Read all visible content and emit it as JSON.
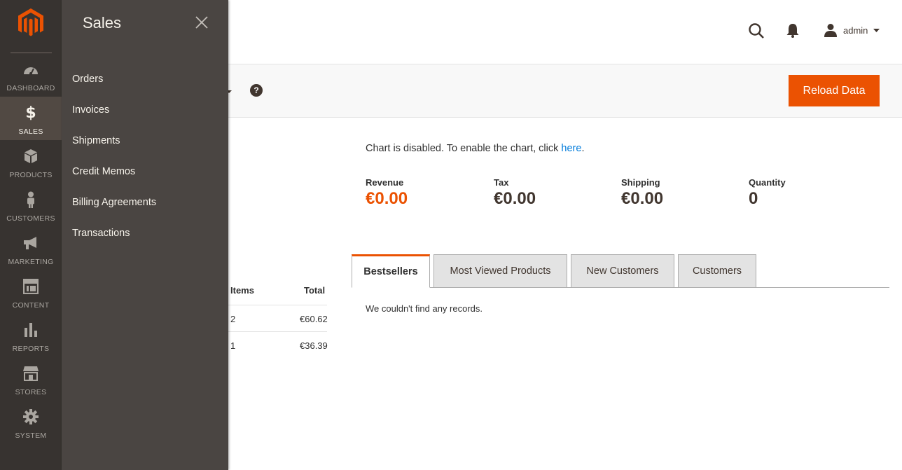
{
  "nav": {
    "items": [
      {
        "label": "DASHBOARD",
        "icon": "dashboard-icon"
      },
      {
        "label": "SALES",
        "icon": "dollar-icon"
      },
      {
        "label": "PRODUCTS",
        "icon": "box-icon"
      },
      {
        "label": "CUSTOMERS",
        "icon": "person-icon"
      },
      {
        "label": "MARKETING",
        "icon": "megaphone-icon"
      },
      {
        "label": "CONTENT",
        "icon": "layout-icon"
      },
      {
        "label": "REPORTS",
        "icon": "bar-chart-icon"
      },
      {
        "label": "STORES",
        "icon": "store-icon"
      },
      {
        "label": "SYSTEM",
        "icon": "gear-icon"
      }
    ],
    "active": "SALES"
  },
  "flyout": {
    "title": "Sales",
    "items": [
      "Orders",
      "Invoices",
      "Shipments",
      "Credit Memos",
      "Billing Agreements",
      "Transactions"
    ]
  },
  "header": {
    "user": "admin"
  },
  "actions": {
    "help_glyph": "?",
    "reload_label": "Reload Data"
  },
  "orders_table": {
    "headers": {
      "items": "Items",
      "total": "Total"
    },
    "rows": [
      {
        "items": "2",
        "total": "€60.62"
      },
      {
        "items": "1",
        "total": "€36.39"
      }
    ]
  },
  "chart_notice": {
    "text": "Chart is disabled. To enable the chart, click ",
    "link": "here",
    "suffix": "."
  },
  "stats": [
    {
      "label": "Revenue",
      "value": "€0.00"
    },
    {
      "label": "Tax",
      "value": "€0.00"
    },
    {
      "label": "Shipping",
      "value": "€0.00"
    },
    {
      "label": "Quantity",
      "value": "0"
    }
  ],
  "tabs": [
    {
      "label": "Bestsellers"
    },
    {
      "label": "Most Viewed Products"
    },
    {
      "label": "New Customers"
    },
    {
      "label": "Customers"
    }
  ],
  "active_tab": "Bestsellers",
  "empty_message": "We couldn't find any records.",
  "colors": {
    "accent": "#eb5202",
    "nav_bg": "#373330",
    "flyout_bg": "#4a4542",
    "link": "#007bdb"
  }
}
